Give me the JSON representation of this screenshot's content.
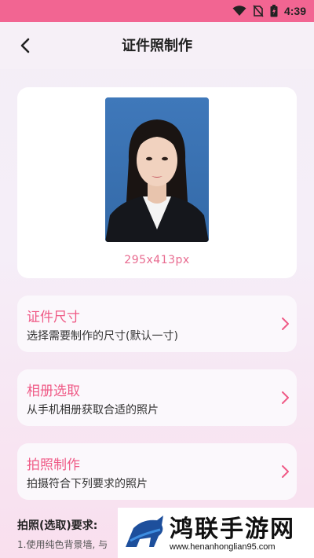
{
  "status_bar": {
    "time": "4:39",
    "icons": [
      "wifi-icon",
      "no-sim-icon",
      "battery-charging-icon"
    ]
  },
  "header": {
    "title": "证件照制作",
    "back_icon": "chevron-left-icon"
  },
  "photo": {
    "size_label": "295x413px"
  },
  "menu": [
    {
      "title": "证件尺寸",
      "desc": "选择需要制作的尺寸(默认一寸)",
      "icon": "chevron-right-icon"
    },
    {
      "title": "相册选取",
      "desc": "从手机相册获取合适的照片",
      "icon": "chevron-right-icon"
    },
    {
      "title": "拍照制作",
      "desc": "拍摄符合下列要求的照片",
      "icon": "chevron-right-icon"
    }
  ],
  "requirements": {
    "title": "拍照(选取)要求:",
    "line1": "1.使用纯色背景墙, 与"
  },
  "watermark": {
    "name": "鸿联手游网",
    "url": "www.henanhonglian95.com"
  },
  "colors": {
    "status_bar": "#f26592",
    "accent": "#ef5a86",
    "size_label": "#e86a8f"
  }
}
